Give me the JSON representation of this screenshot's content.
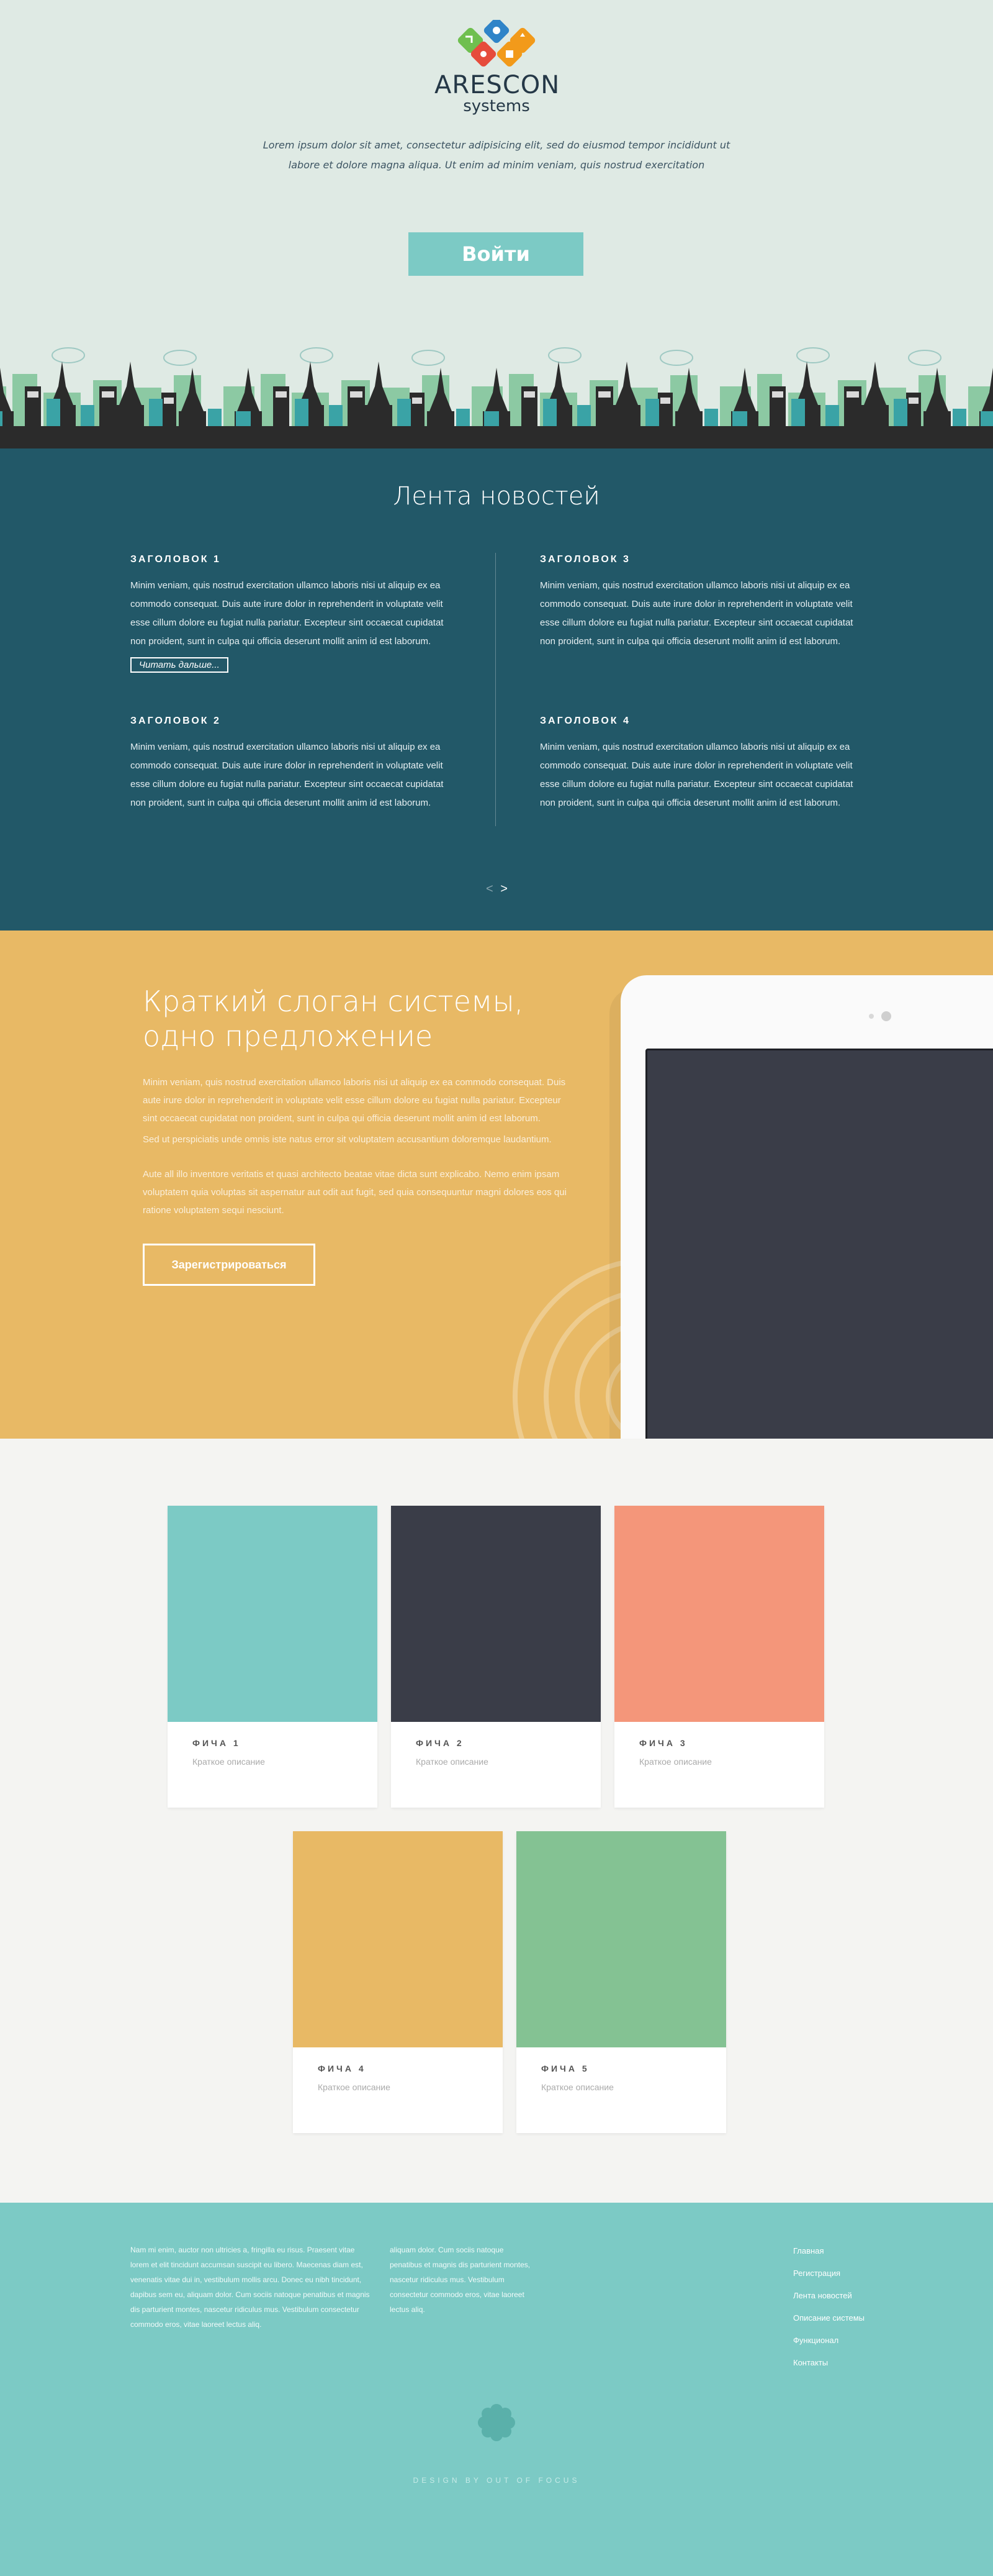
{
  "logo": {
    "name": "ARESCON",
    "sub": "systems",
    "colors": [
      "#6fbf4f",
      "#2f84c8",
      "#e64c3c",
      "#f29a1a"
    ]
  },
  "hero": {
    "text": "Lorem ipsum dolor sit amet, consectetur adipisicing elit, sed do eiusmod tempor incididunt ut labore et dolore magna aliqua. Ut enim ad minim veniam, quis nostrud exercitation",
    "login_label": "Войти"
  },
  "news": {
    "title": "Лента новостей",
    "items": [
      {
        "heading": "ЗАГОЛОВОК 1",
        "body": "Minim veniam, quis nostrud exercitation ullamco laboris nisi ut aliquip ex ea commodo consequat. Duis aute irure dolor in reprehenderit in voluptate velit esse cillum dolore eu fugiat nulla pariatur. Excepteur sint occaecat cupidatat non proident, sunt in culpa qui officia deserunt mollit anim id est laborum."
      },
      {
        "heading": "ЗАГОЛОВОК 2",
        "body": "Minim veniam, quis nostrud exercitation ullamco laboris nisi ut aliquip ex ea commodo consequat. Duis aute irure dolor in reprehenderit in voluptate velit esse cillum dolore eu fugiat nulla pariatur. Excepteur sint occaecat cupidatat non proident, sunt in culpa qui officia deserunt mollit anim id est laborum."
      },
      {
        "heading": "ЗАГОЛОВОК 3",
        "body": "Minim veniam, quis nostrud exercitation ullamco laboris nisi ut aliquip ex ea commodo consequat. Duis aute irure dolor in reprehenderit in voluptate velit esse cillum dolore eu fugiat nulla pariatur. Excepteur sint occaecat cupidatat non proident, sunt in culpa qui officia deserunt mollit anim id est laborum."
      },
      {
        "heading": "ЗАГОЛОВОК 4",
        "body": "Minim veniam, quis nostrud exercitation ullamco laboris nisi ut aliquip ex ea commodo consequat. Duis aute irure dolor in reprehenderit in voluptate velit esse cillum dolore eu fugiat nulla pariatur. Excepteur sint occaecat cupidatat non proident, sunt in culpa qui officia deserunt mollit anim id est laborum."
      }
    ],
    "read_more": "Читать дальше...",
    "prev": "<",
    "next": ">"
  },
  "promo": {
    "title": "Краткий слоган системы, одно предложение",
    "p1": "Minim veniam, quis nostrud exercitation ullamco laboris nisi ut aliquip ex ea commodo consequat. Duis aute irure dolor in reprehenderit in voluptate velit esse cillum dolore eu fugiat nulla pariatur. Excepteur sint occaecat cupidatat non proident, sunt in culpa qui officia deserunt mollit anim id est laborum.",
    "p2": "Sed ut perspiciatis unde omnis iste natus error sit voluptatem accusantium doloremque laudantium.",
    "p3": "Aute all illo inventore veritatis et quasi architecto beatae vitae dicta sunt explicabo. Nemo enim ipsam voluptatem quia voluptas sit aspernatur aut odit aut fugit, sed quia consequuntur magni dolores eos qui ratione voluptatem sequi nesciunt.",
    "signup_label": "Зарегистрироваться"
  },
  "features": [
    {
      "title": "ФИЧА 1",
      "desc": "Краткое описание",
      "color": "#7ccac5"
    },
    {
      "title": "ФИЧА 2",
      "desc": "Краткое описание",
      "color": "#3a3d48"
    },
    {
      "title": "ФИЧА 3",
      "desc": "Краткое описание",
      "color": "#f4967a"
    },
    {
      "title": "ФИЧА 4",
      "desc": "Краткое описание",
      "color": "#e8b965"
    },
    {
      "title": "ФИЧА 5",
      "desc": "Краткое описание",
      "color": "#84c293"
    }
  ],
  "footer": {
    "col1": "Nam mi enim, auctor non ultricies a, fringilla eu risus. Praesent vitae lorem et elit tincidunt accumsan suscipit eu libero. Maecenas diam est, venenatis vitae dui in, vestibulum mollis arcu. Donec eu nibh tincidunt, dapibus sem eu, aliquam dolor. Cum sociis natoque penatibus et magnis dis parturient montes, nascetur ridiculus mus. Vestibulum consectetur commodo eros, vitae laoreet lectus aliq.",
    "col2": "aliquam dolor. Cum sociis natoque penatibus et magnis dis parturient montes, nascetur ridiculus mus. Vestibulum consectetur commodo eros, vitae laoreet lectus aliq.",
    "links": [
      "Главная",
      "Регистрация",
      "Лента новостей",
      "Описание системы",
      "Функционал",
      "Контакты"
    ],
    "credit": "DESIGN BY OUT OF FOCUS"
  }
}
